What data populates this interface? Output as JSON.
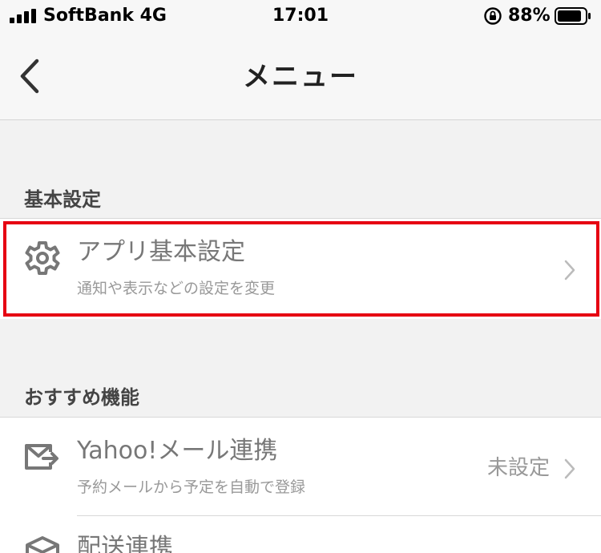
{
  "status_bar": {
    "carrier": "SoftBank 4G",
    "time": "17:01",
    "battery": "88%",
    "battery_level": 0.88
  },
  "nav": {
    "title": "メニュー",
    "back_icon": "chevron-left-icon"
  },
  "sections": [
    {
      "header": "基本設定",
      "items": [
        {
          "icon": "gear-icon",
          "title": "アプリ基本設定",
          "subtitle": "通知や表示などの設定を変更",
          "value": ""
        }
      ]
    },
    {
      "header": "おすすめ機能",
      "items": [
        {
          "icon": "mail-forward-icon",
          "title": "Yahoo!メール連携",
          "subtitle": "予約メールから予定を自動で登録",
          "value": "未設定"
        },
        {
          "icon": "package-icon",
          "title": "配送連携",
          "subtitle": "",
          "value": ""
        }
      ]
    }
  ],
  "colors": {
    "highlight": "#e60012",
    "background": "#f2f2f2",
    "row": "#ffffff"
  }
}
